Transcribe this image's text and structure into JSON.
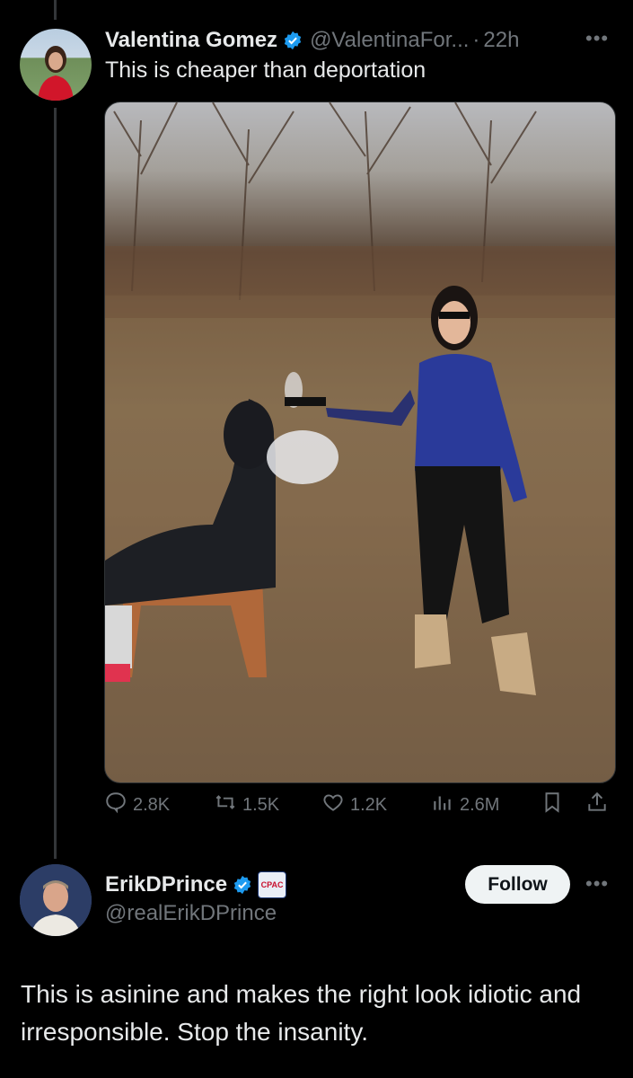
{
  "tweet": {
    "display_name": "Valentina Gomez",
    "handle": "@ValentinaFor...",
    "separator": "·",
    "time": "22h",
    "text": "This is cheaper than deportation",
    "stats": {
      "replies": "2.8K",
      "reposts": "1.5K",
      "likes": "1.2K",
      "views": "2.6M"
    }
  },
  "reply": {
    "display_name": "ErikDPrince",
    "affiliate_badge": "CPAC",
    "handle": "@realErikDPrince",
    "follow_label": "Follow",
    "text": "This is asinine and makes the right look idiotic and irresponsible.  Stop the insanity."
  },
  "colors": {
    "background": "#000000",
    "text": "#e7e9ea",
    "muted": "#71767b",
    "verified": "#1d9bf0",
    "follow_bg": "#eff3f4"
  },
  "icons": [
    "more-icon",
    "verified-icon",
    "reply-icon",
    "repost-icon",
    "like-icon",
    "views-icon",
    "bookmark-icon",
    "share-icon"
  ]
}
